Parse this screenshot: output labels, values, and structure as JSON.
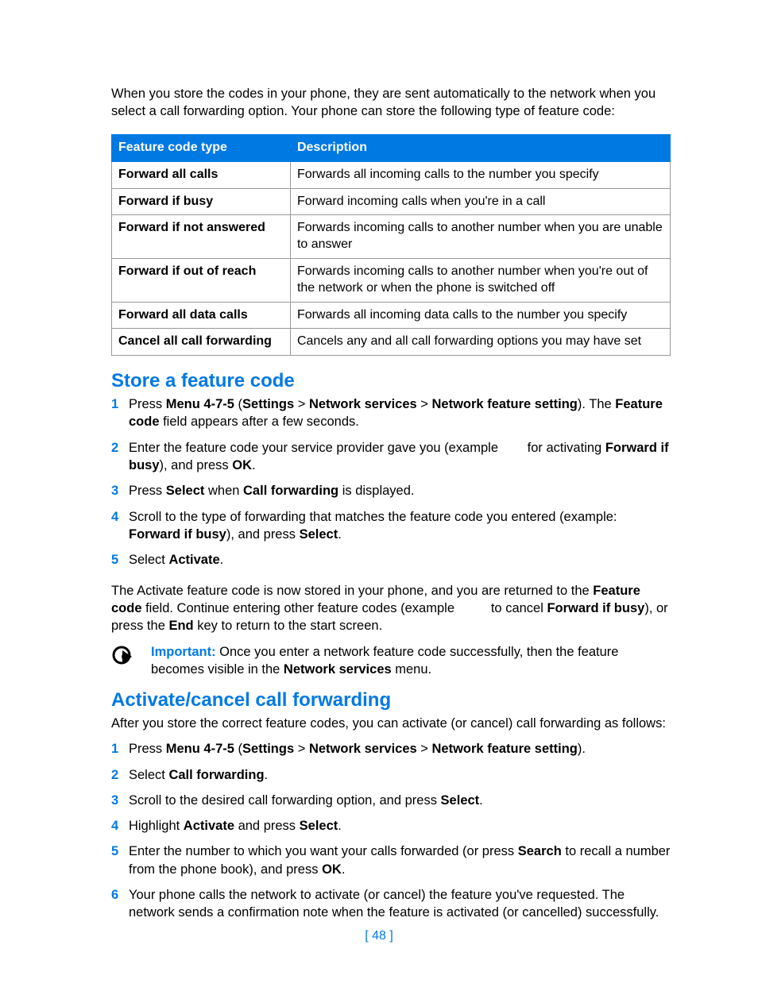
{
  "intro": "When you store the codes in your phone, they are sent automatically to the network when you select a call forwarding option. Your phone can store the following type of feature code:",
  "table": {
    "head_type": "Feature code type",
    "head_desc": "Description",
    "rows": [
      {
        "type": "Forward all calls",
        "desc": "Forwards all incoming calls to the number you specify"
      },
      {
        "type": "Forward if busy",
        "desc": "Forward incoming calls when you're in a call"
      },
      {
        "type": "Forward if not answered",
        "desc": "Forwards incoming calls to another number when you are unable to answer"
      },
      {
        "type": "Forward if out of reach",
        "desc": "Forwards incoming calls to another number when you're out of the network or when the phone is switched off"
      },
      {
        "type": "Forward all data calls",
        "desc": "Forwards all incoming data calls to the number you specify"
      },
      {
        "type": "Cancel all call forwarding",
        "desc": "Cancels any and all call forwarding options you may have set"
      }
    ]
  },
  "section1": {
    "title": "Store a feature code",
    "steps": [
      "Press <b>Menu 4-7-5</b> (<b>Settings</b> > <b>Network services</b> > <b>Network feature setting</b>). The <b>Feature code</b> field appears after a few seconds.",
      "Enter the feature code your service provider gave you (example&nbsp;&nbsp;&nbsp;&nbsp;&nbsp;&nbsp;&nbsp;&nbsp;for activating <b>Forward if busy</b>), and press <b>OK</b>.",
      "Press <b>Select</b> when <b>Call forwarding</b> is displayed.",
      "Scroll to the type of forwarding that matches the feature code you entered (example: <b>Forward if busy</b>), and press <b>Select</b>.",
      "Select <b>Activate</b>."
    ],
    "after": "The Activate feature code is now stored in your phone, and you are returned to the <b>Feature code</b> field. Continue entering other feature codes (example&nbsp;&nbsp;&nbsp;&nbsp;&nbsp;&nbsp;&nbsp;&nbsp;&nbsp;&nbsp;to cancel <b>Forward if busy</b>), or press the <b>End</b> key to return to the start screen.",
    "important_label": "Important:",
    "important_text": " Once you enter a network feature code successfully, then the feature becomes visible in the <b>Network services</b> menu."
  },
  "section2": {
    "title": "Activate/cancel call forwarding",
    "intro": "After you store the correct feature codes, you can activate (or cancel) call forwarding as follows:",
    "steps": [
      "Press <b>Menu 4-7-5</b> (<b>Settings</b> > <b>Network services</b> > <b>Network feature setting</b>).",
      "Select <b>Call forwarding</b>.",
      "Scroll to the desired call forwarding option, and press <b>Select</b>.",
      "Highlight <b>Activate</b> and press <b>Select</b>.",
      "Enter the number to which you want your calls forwarded (or press <b>Search</b> to recall a number from the phone book), and press <b>OK</b>.",
      "Your phone calls the network to activate (or cancel) the feature you've requested. The network sends a confirmation note when the feature is activated (or cancelled) successfully."
    ]
  },
  "page_num": "[ 48 ]"
}
